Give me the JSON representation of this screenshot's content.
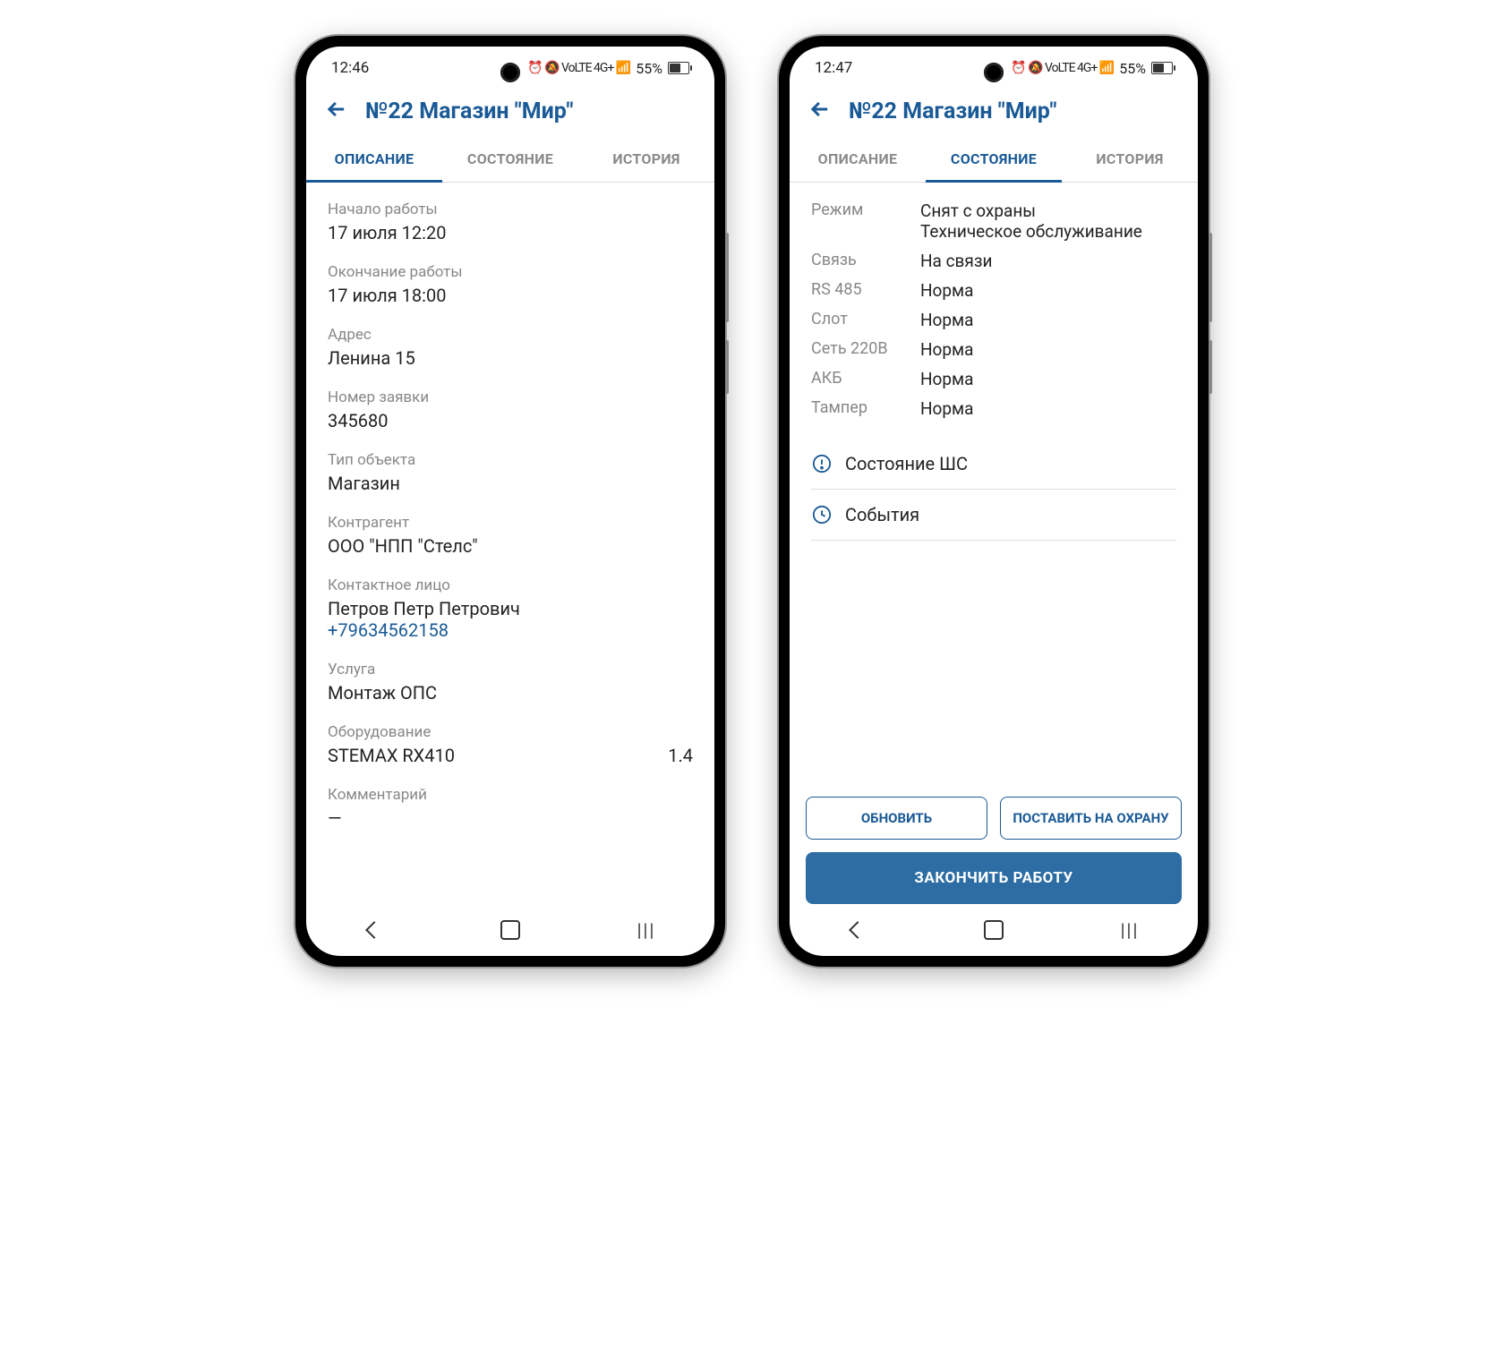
{
  "left": {
    "status_bar": {
      "time": "12:46",
      "battery": "55%"
    },
    "header": {
      "title": "№22 Магазин \"Мир\""
    },
    "tabs": {
      "t0": "ОПИСАНИЕ",
      "t1": "СОСТОЯНИЕ",
      "t2": "ИСТОРИЯ",
      "active": 0
    },
    "fields": {
      "start_label": "Начало работы",
      "start_value": "17 июля 12:20",
      "end_label": "Окончание работы",
      "end_value": "17 июля 18:00",
      "addr_label": "Адрес",
      "addr_value": "Ленина 15",
      "req_label": "Номер заявки",
      "req_value": "345680",
      "type_label": "Тип объекта",
      "type_value": "Магазин",
      "partner_label": "Контрагент",
      "partner_value": "ООО \"НПП \"Стелс\"",
      "contact_label": "Контактное лицо",
      "contact_name": "Петров Петр Петрович",
      "contact_phone": "+79634562158",
      "service_label": "Услуга",
      "service_value": "Монтаж ОПС",
      "equip_label": "Оборудование",
      "equip_name": "STEMAX RX410",
      "equip_ver": "1.4",
      "comment_label": "Комментарий",
      "comment_value": "—"
    }
  },
  "right": {
    "status_bar": {
      "time": "12:47",
      "battery": "55%"
    },
    "header": {
      "title": "№22 Магазин \"Мир\""
    },
    "tabs": {
      "t0": "ОПИСАНИЕ",
      "t1": "СОСТОЯНИЕ",
      "t2": "ИСТОРИЯ",
      "active": 1
    },
    "status_rows": {
      "mode_k": "Режим",
      "mode_v1": "Снят с охраны",
      "mode_v2": "Техническое обслуживание",
      "link_k": "Связь",
      "link_v": "На связи",
      "rs_k": "RS 485",
      "rs_v": "Норма",
      "slot_k": "Слот",
      "slot_v": "Норма",
      "net_k": "Сеть 220В",
      "net_v": "Норма",
      "akb_k": "АКБ",
      "akb_v": "Норма",
      "tamper_k": "Тампер",
      "tamper_v": "Норма"
    },
    "links": {
      "loops": "Состояние ШС",
      "events": "События"
    },
    "buttons": {
      "refresh": "ОБНОВИТЬ",
      "arm": "ПОСТАВИТЬ НА ОХРАНУ",
      "finish": "ЗАКОНЧИТЬ РАБОТУ"
    }
  },
  "status_icons_text": "⏰ 🔕 VoLTE 4G+ 📶"
}
